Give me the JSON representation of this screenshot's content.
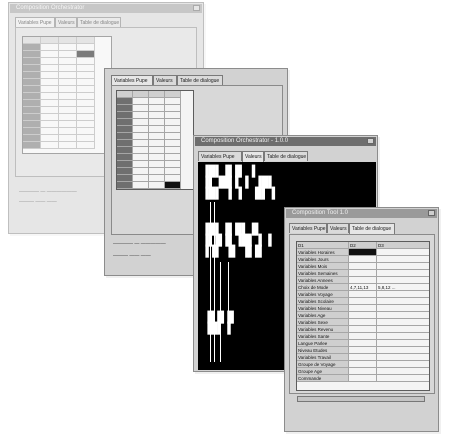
{
  "windows": {
    "w1": {
      "title": "Composition Orchestrator",
      "tabs": [
        "Variables Pupe",
        "Valeurs",
        "Table de dialogue"
      ]
    },
    "w2": {
      "title": "",
      "tabs": [
        "Variables Pupe",
        "Valeurs",
        "Table de dialogue"
      ]
    },
    "w3": {
      "title": "Composition Orchestrator - 1.0.0",
      "tabs": [
        "Variables Pupe",
        "Valeurs",
        "Table de dialogue"
      ]
    },
    "w4": {
      "title": "Composition Tool 1.0",
      "tabs": [
        "Variables Pupe",
        "Valeurs",
        "Table de dialogue"
      ]
    }
  },
  "w4_grid": {
    "headers": [
      "",
      "D1",
      "D2",
      "D3"
    ],
    "rows": [
      [
        "Variables Horaires",
        "",
        ""
      ],
      [
        "Variables Jours",
        "",
        ""
      ],
      [
        "Variables Mois",
        "",
        ""
      ],
      [
        "Variables Semaines",
        "",
        ""
      ],
      [
        "Variables Annees",
        "",
        ""
      ],
      [
        "Choix de Mode",
        "4,7,11,13",
        "5,8,12 ..."
      ],
      [
        "Variables Voyage",
        "",
        ""
      ],
      [
        "Variables Scolaire",
        "",
        ""
      ],
      [
        "Variables Niveau",
        "",
        ""
      ],
      [
        "Variables Age",
        "",
        ""
      ],
      [
        "Variables Sexe",
        "",
        ""
      ],
      [
        "Variables Revenu",
        "",
        ""
      ],
      [
        "Variables Sante",
        "",
        ""
      ],
      [
        "Langue Parlee",
        "",
        ""
      ],
      [
        "Niveau Etudes",
        "",
        ""
      ],
      [
        "Variables Travail",
        "",
        ""
      ],
      [
        "Groupe de Voyage",
        "",
        ""
      ],
      [
        "Groupe Age",
        "",
        ""
      ],
      [
        "Commande",
        "",
        ""
      ]
    ]
  }
}
